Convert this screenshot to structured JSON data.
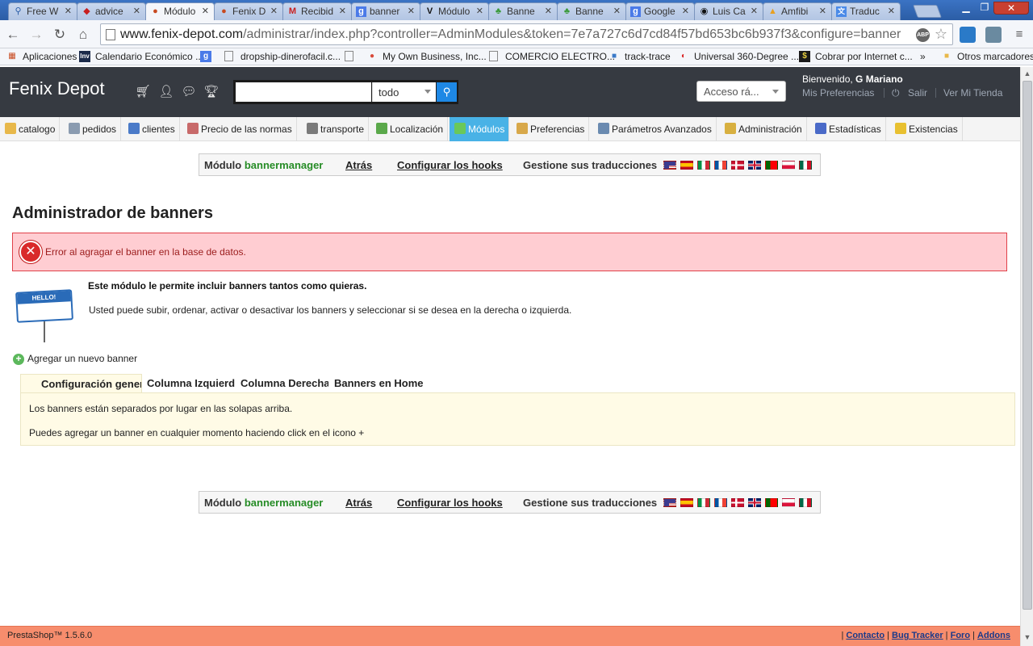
{
  "browser": {
    "tabs": [
      {
        "icon": "search-icon",
        "label": "Free W"
      },
      {
        "icon": "shield-icon",
        "label": "advice"
      },
      {
        "icon": "prestashop-icon",
        "label": "Módulo",
        "active": true
      },
      {
        "icon": "prestashop-icon",
        "label": "Fenix D"
      },
      {
        "icon": "gmail-icon",
        "label": "Recibid"
      },
      {
        "icon": "google-icon",
        "label": "banner"
      },
      {
        "icon": "v-icon",
        "label": "Módulo"
      },
      {
        "icon": "leaf-icon",
        "label": "Banne"
      },
      {
        "icon": "leaf-icon",
        "label": "Banne"
      },
      {
        "icon": "google-icon",
        "label": "Google"
      },
      {
        "icon": "eye-icon",
        "label": "Luis Ca"
      },
      {
        "icon": "amazon-icon",
        "label": "Amfibi"
      },
      {
        "icon": "translate-icon",
        "label": "Traduc"
      }
    ],
    "address": {
      "host": "www.fenix-depot.com",
      "path": "/administrar/index.php?controller=AdminModules&token=7e7a727c6d7cd84f57bd653bc6b937f3&configure=banner"
    },
    "bookmarks": [
      {
        "icon": "apps-icon",
        "label": "Aplicaciones"
      },
      {
        "icon": "inv-icon",
        "label": "Calendario Económico ..."
      },
      {
        "icon": "google-icon",
        "label": ""
      },
      {
        "icon": "page-icon",
        "label": "dropship-dinerofacil.c..."
      },
      {
        "icon": "page-icon",
        "label": ""
      },
      {
        "icon": "circle-icon",
        "label": "My Own Business, Inc..."
      },
      {
        "icon": "page-icon",
        "label": "COMERCIO ELECTRO..."
      },
      {
        "icon": "cube-icon",
        "label": "track-trace"
      },
      {
        "icon": "vodafone-icon",
        "label": "Universal 360-Degree ..."
      },
      {
        "icon": "dollar-icon",
        "label": "Cobrar por Internet c..."
      }
    ],
    "bookmarks_overflow": "»",
    "other_bookmarks": "Otros marcadores"
  },
  "header": {
    "shop_name": "Fenix Depot",
    "search_scope": "todo",
    "quick_access": "Acceso rá...",
    "welcome_prefix": "Bienvenido, ",
    "welcome_user": "G Mariano",
    "preferences": "Mis Preferencias",
    "logout": "Salir",
    "view_store": "Ver Mi Tienda"
  },
  "menu": [
    {
      "label": "catalogo",
      "color": "#e8b84a"
    },
    {
      "label": "pedidos",
      "color": "#8a9bb0"
    },
    {
      "label": "clientes",
      "color": "#4a7ac8"
    },
    {
      "label": "Precio de las normas",
      "color": "#c86a6a"
    },
    {
      "label": "transporte",
      "color": "#7a7a7a"
    },
    {
      "label": "Localización",
      "color": "#5aa84a"
    },
    {
      "label": "Módulos",
      "color": "#6ac85a",
      "active": true
    },
    {
      "label": "Preferencias",
      "color": "#d8a84a"
    },
    {
      "label": "Parámetros Avanzados",
      "color": "#6a8ab0"
    },
    {
      "label": "Administración",
      "color": "#d8b040"
    },
    {
      "label": "Estadísticas",
      "color": "#4a6ac8"
    },
    {
      "label": "Existencias",
      "color": "#e8c030"
    }
  ],
  "module_toolbar": {
    "module_prefix": "Módulo ",
    "module_name": "bannermanager",
    "back": "Atrás",
    "hooks": "Configurar los hooks",
    "translations": "Gestione sus traducciones",
    "flags": [
      "us",
      "es",
      "it",
      "fr",
      "dk",
      "gb",
      "pt",
      "pl",
      "mx"
    ]
  },
  "page": {
    "title": "Administrador de banners",
    "error": "Error al agragar el banner en la base de datos.",
    "description_bold": "Este módulo le permite incluir banners tantos como quieras.",
    "description": "Usted puede subir, ordenar, activar o desactivar los banners y seleccionar si se desea en la derecha o izquierda.",
    "add_banner": "Agregar un nuevo banner",
    "tabs": [
      "Configuración general",
      "Columna Izquierda",
      "Columna Derecha",
      "Banners en Home"
    ],
    "panel_lines": [
      "Los banners están separados por lugar en las solapas arriba.",
      "Puedes agregar un banner en cualquier momento haciendo click en el icono +"
    ]
  },
  "footer": {
    "version": "PrestaShop™ 1.5.6.0",
    "links": [
      "Contacto",
      "Bug Tracker",
      "Foro",
      "Addons"
    ]
  }
}
